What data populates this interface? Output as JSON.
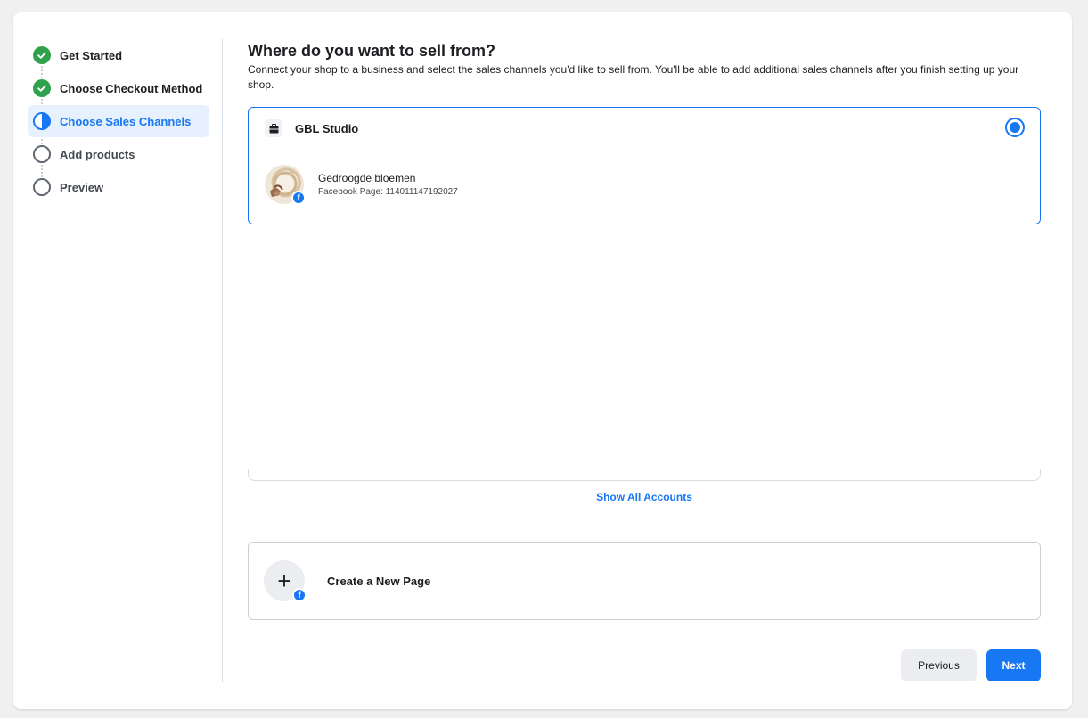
{
  "steps": [
    {
      "label": "Get Started",
      "state": "done"
    },
    {
      "label": "Choose Checkout Method",
      "state": "done"
    },
    {
      "label": "Choose Sales Channels",
      "state": "active"
    },
    {
      "label": "Add products",
      "state": "pending"
    },
    {
      "label": "Preview",
      "state": "pending"
    }
  ],
  "main": {
    "title": "Where do you want to sell from?",
    "subtitle": "Connect your shop to a business and select the sales channels you'd like to sell from. You'll be able to add additional sales channels after you finish setting up your shop."
  },
  "business": {
    "name": "GBL Studio",
    "selected": true,
    "page": {
      "name": "Gedroogde bloemen",
      "id_text": "Facebook Page: 114011147192027"
    }
  },
  "show_all_label": "Show All Accounts",
  "create_page_label": "Create a New Page",
  "footer": {
    "previous_label": "Previous",
    "next_label": "Next"
  },
  "colors": {
    "accent": "#1877f2",
    "success": "#31a24c",
    "active_bg": "#e7f0fd"
  },
  "icons": {
    "done": "check-circle-icon",
    "active": "half-circle-icon",
    "pending": "empty-circle-icon",
    "business": "briefcase-icon",
    "badge": "facebook-icon",
    "create": "plus-icon"
  }
}
